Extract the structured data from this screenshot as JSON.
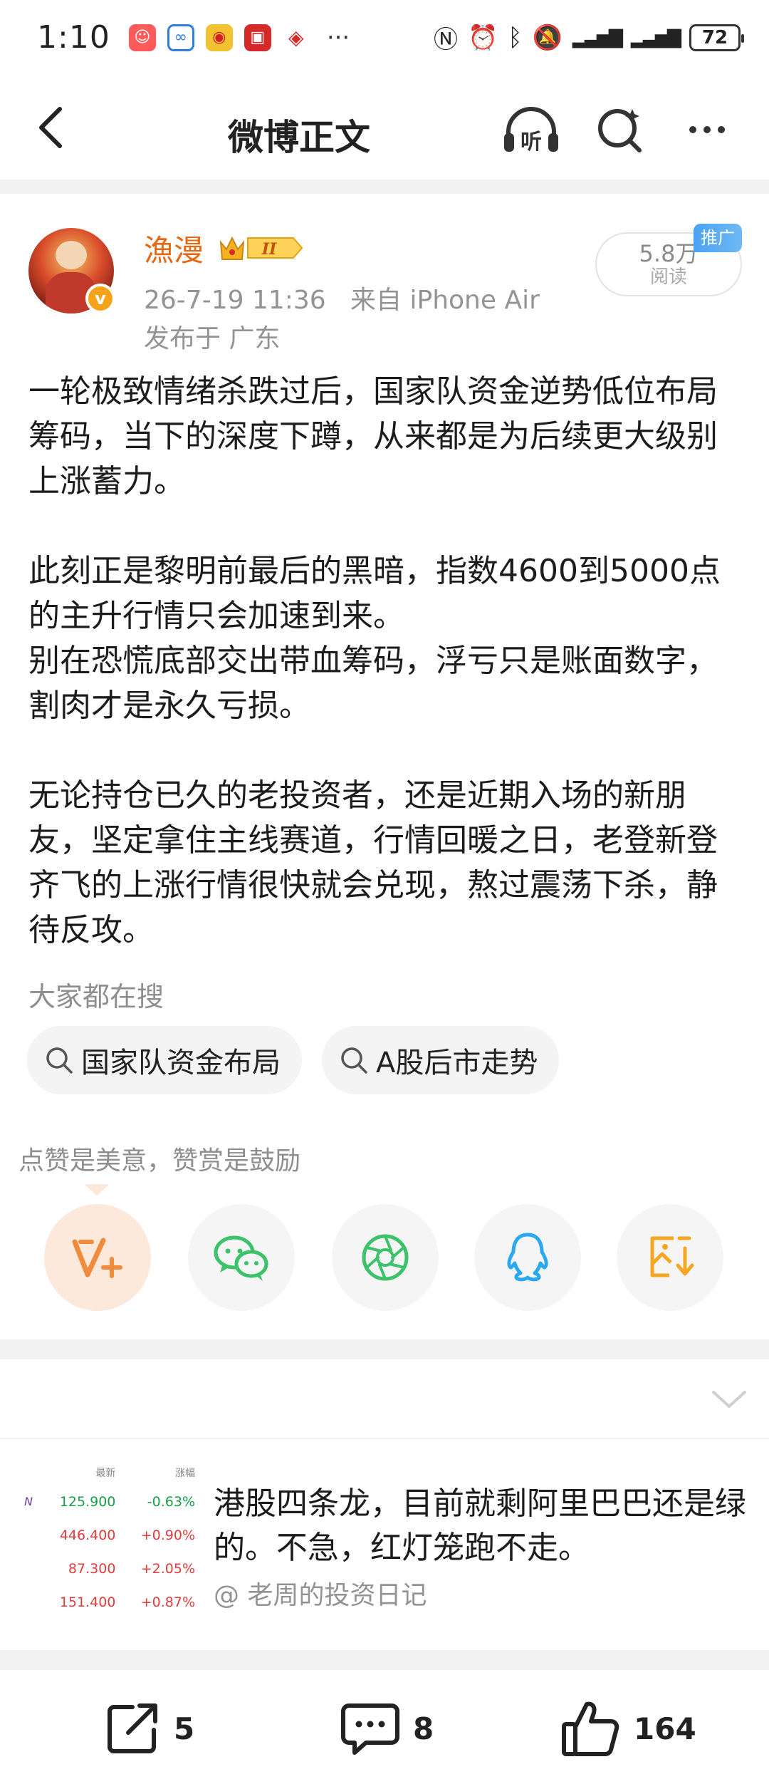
{
  "status_bar": {
    "time": "1:10",
    "more": "···",
    "battery": "72"
  },
  "nav": {
    "title": "微博正文",
    "listen_label": "听"
  },
  "post": {
    "author": "漁漫",
    "timestamp": "26-7-19 11:36",
    "source": "来自 iPhone Air",
    "location": "发布于 广东",
    "reads_count": "5.8万",
    "reads_label": "阅读",
    "promo_tag": "推广",
    "paragraphs": [
      "一轮极致情绪杀跌过后，国家队资金逆势低位布局筹码，当下的深度下蹲，从来都是为后续更大级别上涨蓄力。",
      "此刻正是黎明前最后的黑暗，指数4600到5000点的主升行情只会加速到来。",
      "别在恐慌底部交出带血筹码，浮亏只是账面数字，割肉才是永久亏损。",
      "无论持仓已久的老投资者，还是近期入场的新朋友，坚定拿住主线赛道，行情回暖之日，老登新登齐飞的上涨行情很快就会兑现，熬过震荡下杀，静待反攻。"
    ]
  },
  "trending": {
    "title": "大家都在搜",
    "chips": [
      "国家队资金布局",
      "A股后市走势"
    ]
  },
  "reward": {
    "hint": "点赞是美意，赞赏是鼓励"
  },
  "share_targets": [
    {
      "icon": "reward-v-icon",
      "color": "#f08a3c"
    },
    {
      "icon": "wechat-icon",
      "color": "#3cc36a"
    },
    {
      "icon": "moments-icon",
      "color": "#3cc36a"
    },
    {
      "icon": "qq-icon",
      "color": "#2ba8f0"
    },
    {
      "icon": "save-image-icon",
      "color": "#f5a623"
    }
  ],
  "recommendation": {
    "thumb_headers": [
      "最新",
      "涨幅"
    ],
    "thumb_mark": "N",
    "thumb_rows": [
      {
        "price": "125.900",
        "change": "-0.63%",
        "color": "#1b9e4b"
      },
      {
        "price": "446.400",
        "change": "+0.90%",
        "color": "#e23b3b"
      },
      {
        "price": "87.300",
        "change": "+2.05%",
        "color": "#e23b3b"
      },
      {
        "price": "151.400",
        "change": "+0.87%",
        "color": "#e23b3b"
      }
    ],
    "text": "港股四条龙，目前就剩阿里巴巴还是绿的。不急，红灯笼跑不走。",
    "author": "@ 老周的投资日记"
  },
  "bottom_bar": {
    "reposts": "5",
    "comments": "8",
    "likes": "164"
  },
  "colors": {
    "accent_orange": "#e8670f",
    "meta_gray": "#939393",
    "band_gray": "#f1f1f1"
  }
}
